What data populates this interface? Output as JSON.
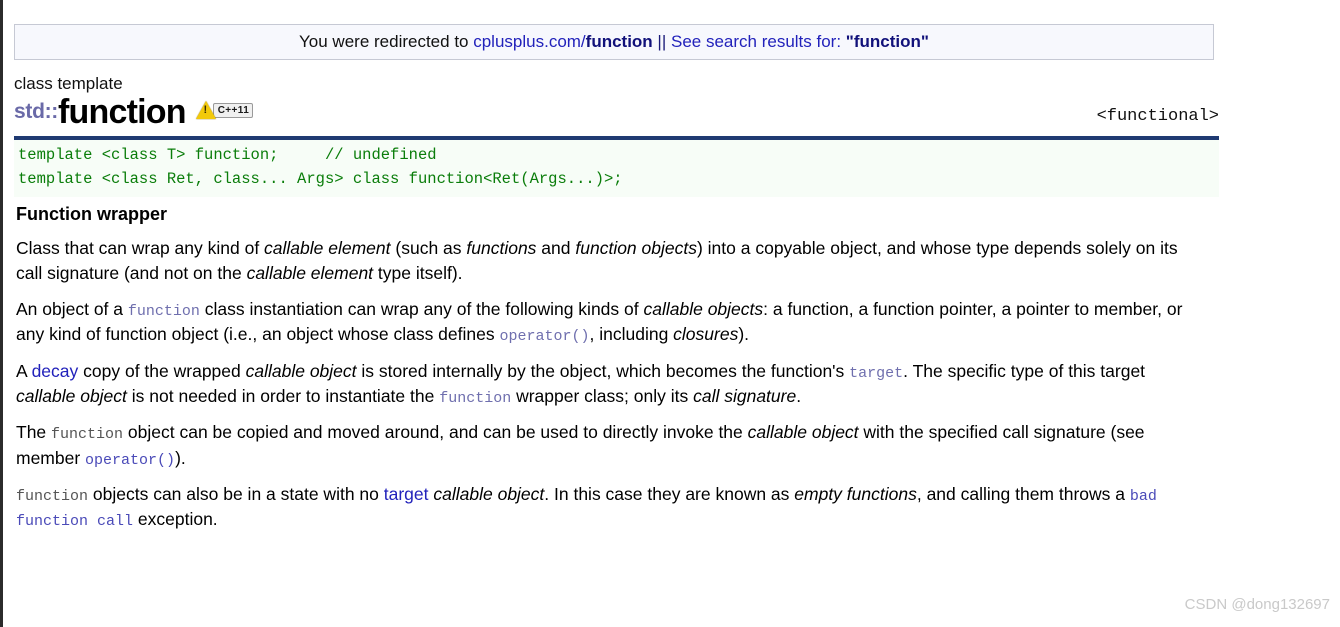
{
  "banner": {
    "prefix": "You were redirected to ",
    "link_domain": "cplusplus.com/",
    "link_bold": "function",
    "separator": " || ",
    "search_text": "See search results for: ",
    "search_query": "\"function\""
  },
  "title": {
    "kind": "class template",
    "namespace": "std::",
    "name": "function",
    "badge_icon": "warning-triangle-icon",
    "badge_label": "C++11",
    "header": "<functional>"
  },
  "code": {
    "line1": "template <class T> function;     // undefined",
    "line2": "template <class Ret, class... Args> class function<Ret(Args...)>;"
  },
  "content": {
    "subheading": "Function wrapper",
    "p1": {
      "t1": "Class that can wrap any kind of ",
      "i1": "callable element",
      "t2": " (such as ",
      "i2": "functions",
      "t3": " and ",
      "i3": "function objects",
      "t4": ") into a copyable object, and whose type depends solely on its call signature (and not on the ",
      "i4": "callable element",
      "t5": " type itself)."
    },
    "p2": {
      "t1": "An object of a ",
      "c1": "function",
      "t2": " class instantiation can wrap any of the following kinds of ",
      "i1": "callable objects",
      "t3": ": a function, a function pointer, a pointer to member, or any kind of function object (i.e., an object whose class defines ",
      "c2": "operator()",
      "t4": ", including ",
      "i2": "closures",
      "t5": ")."
    },
    "p3": {
      "t1": "A ",
      "l1": "decay",
      "t2": " copy of the wrapped ",
      "i1": "callable object",
      "t3": " is stored internally by the object, which becomes the function's ",
      "c1": "target",
      "t4": ". The specific type of this target ",
      "i2": "callable object",
      "t5": " is not needed in order to instantiate the ",
      "c2": "function",
      "t6": " wrapper class; only its ",
      "i3": "call signature",
      "t7": "."
    },
    "p4": {
      "t1": "The ",
      "c1": "function",
      "t2": " object can be copied and moved around, and can be used to directly invoke the ",
      "i1": "callable object",
      "t3": " with the specified call signature (see member ",
      "l1": "operator()",
      "t4": ")."
    },
    "p5": {
      "c1": "function",
      "t1": " objects can also be in a state with no ",
      "l1": "target",
      "t2": " ",
      "i1": "callable object",
      "t3": ". In this case they are known as ",
      "i2": "empty functions",
      "t4": ", and calling them throws a ",
      "l2": "bad function call",
      "t5": " exception."
    }
  },
  "watermark": "CSDN @dong132697",
  "colors": {
    "navy_rule": "#1f3a72",
    "code_green": "#0a7d0a",
    "link_blue": "#2222bb",
    "mono_purple": "#6f6fae",
    "badge_yellow": "#f2c90a"
  }
}
